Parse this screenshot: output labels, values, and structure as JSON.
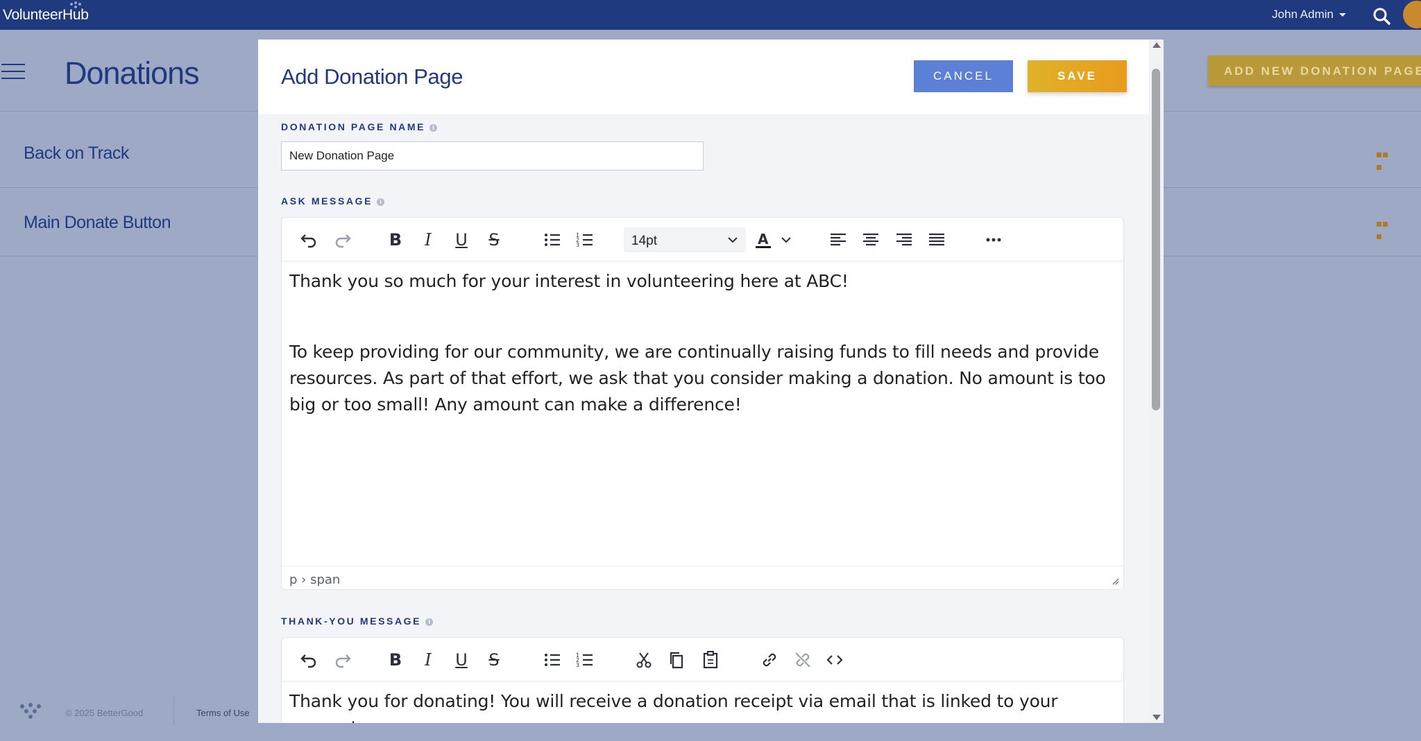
{
  "app": {
    "brand": "VolunteerHub",
    "user": "John Admin"
  },
  "page": {
    "title": "Donations",
    "add_button": "ADD NEW DONATION PAGE",
    "items": [
      {
        "label": "Back on Track"
      },
      {
        "label": "Main Donate Button"
      }
    ],
    "footer": {
      "copyright": "© 2025 BetterGood",
      "terms": "Terms of Use"
    }
  },
  "modal": {
    "title": "Add Donation Page",
    "cancel_label": "CANCEL",
    "save_label": "SAVE",
    "name_label": "DONATION PAGE NAME",
    "name_value": "New Donation Page",
    "ask_label": "ASK MESSAGE",
    "ask_editor": {
      "font_size": "14pt",
      "paragraph_1": "Thank you so much for your interest in volunteering here at ABC!",
      "paragraph_2": "To keep providing for our community, we are continually raising funds to fill needs and provide resources. As part of that effort, we ask that you consider making a donation. No amount is too big or too small! Any amount can make a difference!",
      "status_path": "p › span"
    },
    "thanks_label": "THANK-YOU MESSAGE",
    "thanks_editor": {
      "paragraph_1": "Thank you for donating! You will receive a donation receipt via email that is linked to your account."
    }
  },
  "colors": {
    "nav": "#1f3a7f",
    "accent": "#5b80d6",
    "save": "#e0a823"
  }
}
